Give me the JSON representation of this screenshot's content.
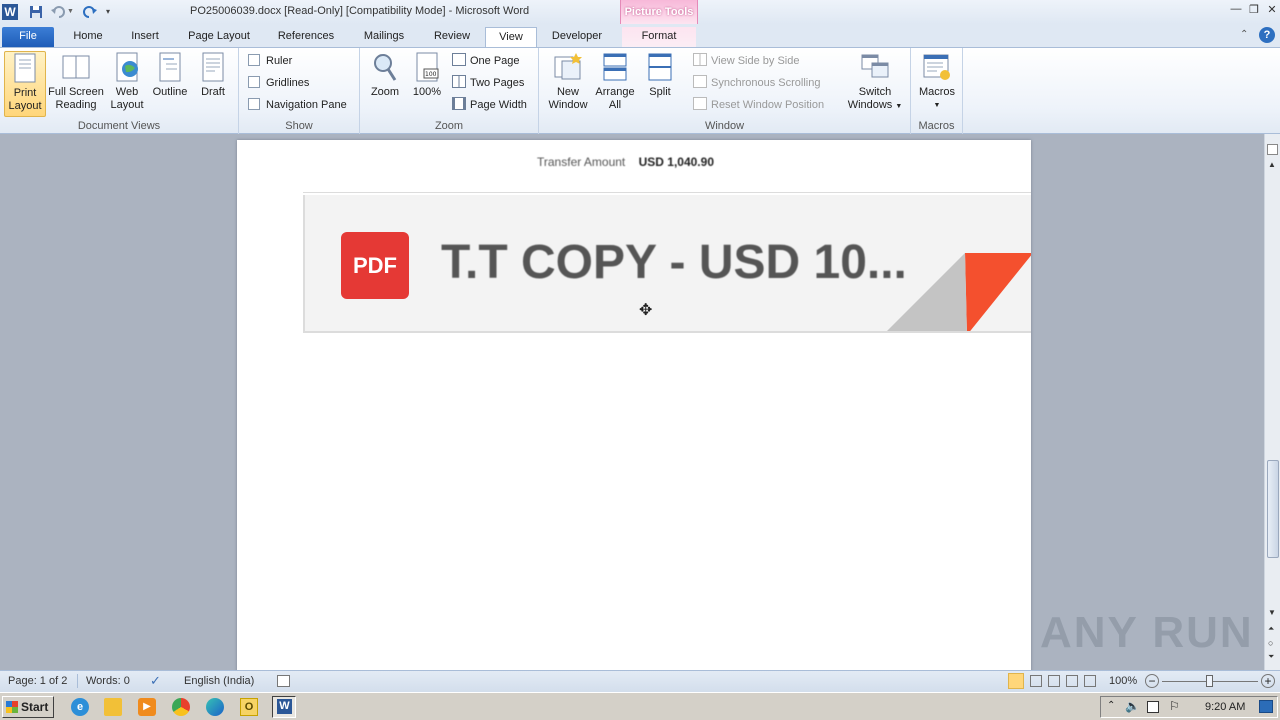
{
  "titlebar": {
    "title": "PO25006039.docx [Read-Only] [Compatibility Mode]  -  Microsoft Word",
    "context_group": "Picture Tools"
  },
  "tabs": [
    "File",
    "Home",
    "Insert",
    "Page Layout",
    "References",
    "Mailings",
    "Review",
    "View",
    "Developer",
    "Format"
  ],
  "ribbon": {
    "document_views": {
      "name": "Document Views",
      "print_layout": [
        "Print",
        "Layout"
      ],
      "full_screen": [
        "Full Screen",
        "Reading"
      ],
      "web_layout": [
        "Web",
        "Layout"
      ],
      "outline": "Outline",
      "draft": "Draft"
    },
    "show": {
      "name": "Show",
      "ruler": "Ruler",
      "gridlines": "Gridlines",
      "nav_pane": "Navigation Pane"
    },
    "zoom": {
      "name": "Zoom",
      "zoom": "Zoom",
      "hundred": "100%",
      "one_page": "One Page",
      "two_pages": "Two Pages",
      "page_width": "Page Width"
    },
    "window": {
      "name": "Window",
      "new_window": [
        "New",
        "Window"
      ],
      "arrange_all": [
        "Arrange",
        "All"
      ],
      "split": "Split",
      "side_by_side": "View Side by Side",
      "sync_scroll": "Synchronous Scrolling",
      "reset_pos": "Reset Window Position",
      "switch_windows": [
        "Switch",
        "Windows"
      ]
    },
    "macros": {
      "name": "Macros",
      "macros": "Macros"
    }
  },
  "document": {
    "transfer_label": "Transfer Amount",
    "transfer_value": "USD 1,040.90",
    "attachment_icon_text": "PDF",
    "attachment_title": "T.T COPY - USD 10..."
  },
  "statusbar": {
    "page": "Page: 1 of 2",
    "words": "Words: 0",
    "language": "English (India)",
    "zoom": "100%"
  },
  "taskbar": {
    "start": "Start",
    "time": "9:20 AM"
  },
  "watermark": "ANY RUN",
  "colors": {
    "file_tab": "#2a6bc9",
    "pdf_red": "#e53935",
    "accent_orange": "#f4502e"
  }
}
